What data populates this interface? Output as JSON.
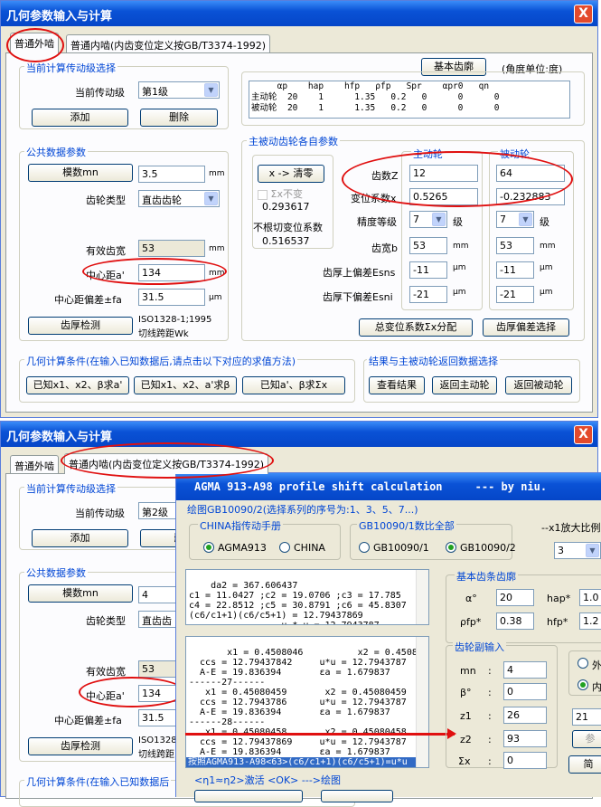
{
  "w1": {
    "title": "几何参数输入与计算",
    "close": "X",
    "tabs": [
      "普通外啮",
      "普通内啮(内齿变位定义按GB/T3374-1992)"
    ],
    "g_level": "当前计算传动级选择",
    "cur_level_lbl": "当前传动级",
    "cur_level": "第1级",
    "add": "添加",
    "del": "删除",
    "g_common": "公共数据参数",
    "mod_btn": "模数mn",
    "mod_val": "3.5",
    "mm": "mm",
    "gear_type_lbl": "齿轮类型",
    "gear_type": "直齿齿轮",
    "eff_lbl": "有效齿宽",
    "eff_val": "53",
    "cd_lbl": "中心距a'",
    "cd_val": "134",
    "cdtol_lbl": "中心距偏差±fa",
    "cdtol_val": "31.5",
    "um": "μm",
    "thick_btn": "齿厚检测",
    "thick_note1": "ISO1328-1;1995",
    "thick_note2": "切线跨距Wk",
    "basic_btn": "基本齿廓",
    "angle_unit": "(角度单位:度)",
    "prof_hdr": "     αp    hap    hfp   ρfp   Spr    αpr0   qn",
    "prof_r1": "主动轮  20    1      1.35   0.2   0      0      0",
    "prof_r2": "被动轮  20    1      1.35   0.2   0      0      0",
    "g_each": "主被动齿轮各自参数",
    "xbtn": "x -> 清零",
    "sumx_chk": "Σx不变",
    "v1": "0.293617",
    "nocut": "不根切变位系数",
    "v2": "0.516537",
    "drive_hdr": "主动轮",
    "driven_hdr": "被动轮",
    "z_lbl": "齿数Z",
    "z1": "12",
    "z2": "64",
    "x_lbl": "变位系数x",
    "x1": "0.5265",
    "x2": "-0.232883",
    "acc_lbl": "精度等级",
    "acc1": "7",
    "acc2": "7",
    "lvl": "级",
    "fw_lbl": "齿宽b",
    "fw1": "53",
    "fw2": "53",
    "esns_lbl": "齿厚上偏差Esns",
    "esns1": "-11",
    "esns2": "-11",
    "esni_lbl": "齿厚下偏差Esni",
    "esni1": "-21",
    "esni2": "-21",
    "sumx_btn": "总变位系数Σx分配",
    "tdev_btn": "齿厚偏差选择",
    "g_geo": "几何计算条件(在输入已知数据后,请点击以下对应的求值方法)",
    "m1": "已知x1、x2、β求a'",
    "m2": "已知x1、x2、a'求β",
    "m3": "已知a'、β求Σx",
    "g_ret": "结果与主被动轮返回数据选择",
    "r1": "查看结果",
    "r2": "返回主动轮",
    "r3": "返回被动轮"
  },
  "w2": {
    "title": "几何参数输入与计算",
    "close": "X",
    "tabs": [
      "普通外啮",
      "普通内啮(内齿变位定义按GB/T3374-1992)"
    ],
    "g_level": "当前计算传动级选择",
    "cur_level_lbl": "当前传动级",
    "cur_level": "第2级",
    "add": "添加",
    "del": "删",
    "g_common": "公共数据参数",
    "mod_btn": "模数mn",
    "mod_val": "4",
    "gear_type_lbl": "齿轮类型",
    "gear_type": "直齿齿",
    "eff_lbl": "有效齿宽",
    "eff_val": "53",
    "cd_lbl": "中心距a'",
    "cd_val": "134",
    "cdtol_lbl": "中心距偏差±fa",
    "cdtol_val": "31.5",
    "thick_btn": "齿厚检测",
    "thick_note1": "ISO1328",
    "thick_note2": "切线跨距",
    "g_geo": "几何计算条件(在输入已知数据后"
  },
  "w3": {
    "title": "AGMA 913-A98 profile shift calculation     --- by niu.",
    "draw_lbl": "绘图GB10090/2(选择系列的序号为:1、3、5、7...)",
    "g_hand": "CHINA指传动手册",
    "rb_agma": "AGMA913",
    "rb_china": "CHINA",
    "g_gb": "GB10090/1数比全部",
    "rb_gb1": "GB10090/1",
    "rb_gb2": "GB10090/2",
    "mag_lbl": "--x1放大比例",
    "mag_val": "3",
    "box1": "da2 = 367.606437\nc1 = 11.0427 ;c2 = 19.0706 ;c3 = 17.785\nc4 = 22.8512 ;c5 = 30.8791 ;c6 = 45.8307\n(c6/c1+1)(c6/c5+1) = 12.79437869\n                 u * u = 12.7943787",
    "box2": "   x1 = 0.4508046          x2 = 0.4508046\n  ccs = 12.79437842     u*u = 12.7943787\n  A-E = 19.836394       εa = 1.679837\n------27------\n   x1 = 0.45080459       x2 = 0.45080459\n  ccs = 12.7943786      u*u = 12.7943787\n  A-E = 19.836394       εa = 1.679837\n------28------\n   x1 = 0.45080458       x2 = 0.45080458\n  ccs = 12.79437869     u*u = 12.7943787\n  A-E = 19.836394       εa = 1.679837",
    "box2_last": "按照AGMA913-A98<63>(c6/c1+1)(c6/c5+1)=u*u",
    "g_basic": "基本齿条齿廓",
    "alpha_lbl": "α°",
    "alpha": "20",
    "hap_lbl": "hap*",
    "hap": "1.0",
    "rho_lbl": "ρfp*",
    "rho": "0.38",
    "hfp_lbl": "hfp*",
    "hfp": "1.2",
    "g_pair": "齿轮副输入",
    "mn_lbl": "mn",
    "mn": "4",
    "beta_lbl": "β°",
    "beta": "0",
    "z1_lbl": "z1",
    "z1": "26",
    "z2_lbl": "z2",
    "z2": "93",
    "sx_lbl": "Σx",
    "sx": "0",
    "colon": ":",
    "rb_out": "外",
    "rb_in": "内",
    "right_val": "21",
    "right_btn1": "参",
    "right_btn2": "简",
    "footer": "<η1≈η2>激活 <OK> --->绘图"
  },
  "colors": {
    "title": "#0a52d6",
    "accent": "#0046d5",
    "annot": "#e01010"
  }
}
